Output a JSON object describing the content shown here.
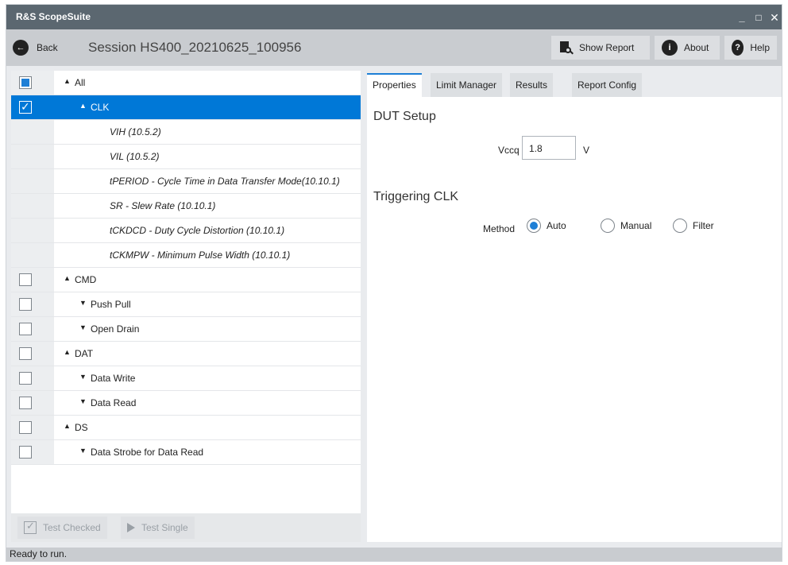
{
  "window": {
    "title": "R&S ScopeSuite",
    "minimize": "_",
    "maximize": "□",
    "close": "✕"
  },
  "toolbar": {
    "back_label": "Back",
    "session": "Session  HS400_20210625_100956",
    "show_report": "Show Report",
    "about": "About",
    "help": "Help"
  },
  "tree": {
    "items": [
      {
        "label": "All",
        "arrow": "▲",
        "checkbox": "partial"
      },
      {
        "label": "CLK",
        "arrow": "▲",
        "checkbox": "checked",
        "selected": true
      },
      {
        "label": "VIH (10.5.2)"
      },
      {
        "label": "VIL (10.5.2)"
      },
      {
        "label": "tPERIOD - Cycle Time in Data Transfer Mode(10.10.1)"
      },
      {
        "label": "SR - Slew Rate (10.10.1)"
      },
      {
        "label": "tCKDCD - Duty Cycle Distortion (10.10.1)"
      },
      {
        "label": "tCKMPW - Minimum Pulse Width (10.10.1)"
      },
      {
        "label": "CMD",
        "arrow": "▲",
        "checkbox": "unchecked"
      },
      {
        "label": "Push Pull",
        "arrow": "▼",
        "checkbox": "unchecked"
      },
      {
        "label": "Open Drain",
        "arrow": "▼",
        "checkbox": "unchecked"
      },
      {
        "label": "DAT",
        "arrow": "▲",
        "checkbox": "unchecked"
      },
      {
        "label": "Data Write",
        "arrow": "▼",
        "checkbox": "unchecked"
      },
      {
        "label": "Data Read",
        "arrow": "▼",
        "checkbox": "unchecked"
      },
      {
        "label": "DS",
        "arrow": "▲",
        "checkbox": "unchecked"
      },
      {
        "label": "Data Strobe for Data Read",
        "arrow": "▼",
        "checkbox": "unchecked"
      }
    ]
  },
  "actions": {
    "test_checked": "Test Checked",
    "test_single": "Test Single"
  },
  "tabs": [
    {
      "label": "Properties",
      "active": true
    },
    {
      "label": "Limit Manager"
    },
    {
      "label": "Results"
    },
    {
      "label": "Report Config"
    }
  ],
  "properties": {
    "dut_setup_title": "DUT Setup",
    "vccq_label": "Vccq",
    "vccq_value": "1.8",
    "vccq_unit": "V",
    "triggering_title": "Triggering CLK",
    "method_label": "Method",
    "methods": [
      {
        "label": "Auto",
        "selected": true
      },
      {
        "label": "Manual",
        "selected": false
      },
      {
        "label": "Filter",
        "selected": false
      }
    ]
  },
  "status": {
    "text": "Ready to run."
  },
  "colors": {
    "accent": "#0078d7",
    "titlebar": "#5b6770",
    "toolbar": "#c9ccd0"
  }
}
